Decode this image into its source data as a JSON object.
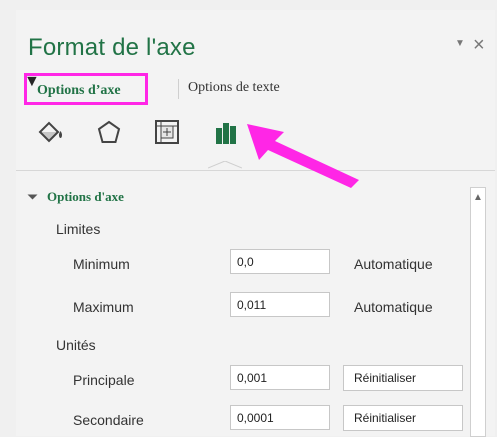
{
  "panel": {
    "title": "Format de l'axe",
    "tabs": [
      {
        "label": "Options d’axe",
        "active": true
      },
      {
        "label": "Options de texte",
        "active": false
      }
    ]
  },
  "icons": [
    {
      "name": "fill-line-icon"
    },
    {
      "name": "effects-icon"
    },
    {
      "name": "size-properties-icon"
    },
    {
      "name": "axis-options-icon",
      "selected": true
    }
  ],
  "section": {
    "title": "Options d'axe",
    "groups": [
      {
        "label": "Limites",
        "fields": [
          {
            "label": "Minimum",
            "value": "0,0",
            "right": "Automatique"
          },
          {
            "label": "Maximum",
            "value": "0,011",
            "right": "Automatique"
          }
        ]
      },
      {
        "label": "Unités",
        "fields": [
          {
            "label": "Principale",
            "value": "0,001",
            "button": "Réinitialiser"
          },
          {
            "label": "Secondaire",
            "value": "0,0001",
            "button": "Réinitialiser"
          }
        ]
      }
    ]
  },
  "colors": {
    "accent": "#217346",
    "highlight": "#ff26e6"
  }
}
